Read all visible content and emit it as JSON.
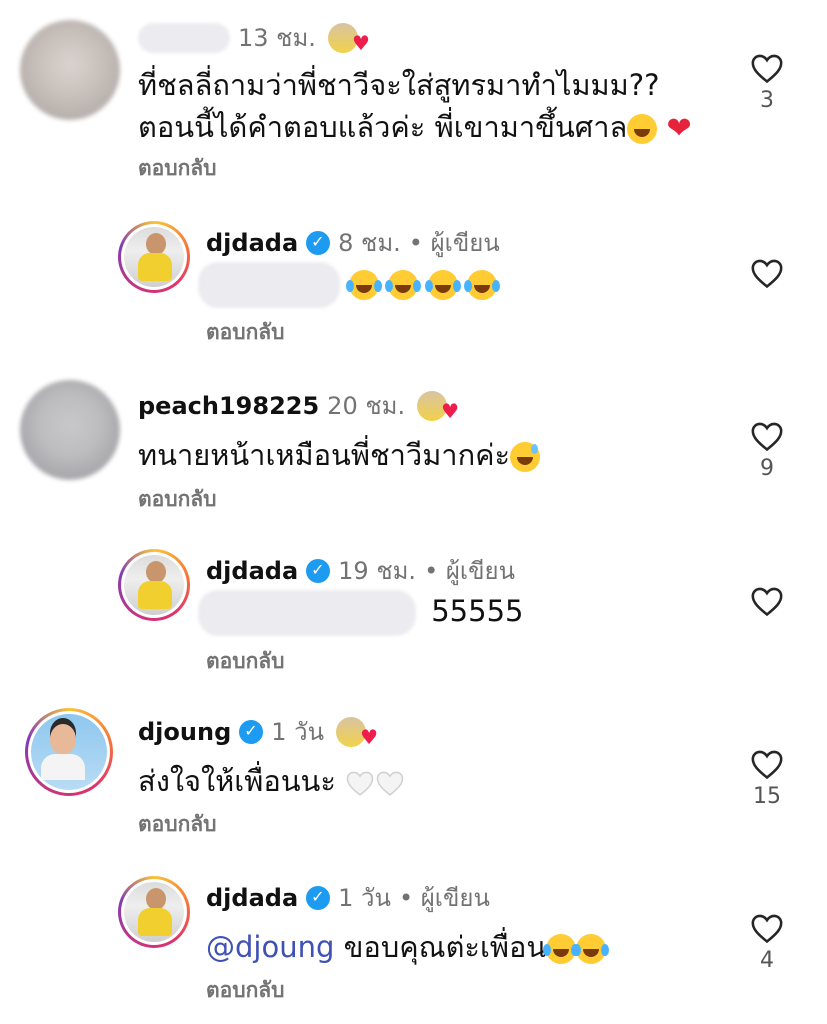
{
  "comments": [
    {
      "username": "",
      "time": "13 ชม.",
      "text_line1": "ที่ชลลี่ถามว่าพี่ชาวีจะใส่สูทรมาทำไมมม??",
      "text_line2": "ตอนนี้ได้คำตอบแล้วค่ะ พี่เขามาขึ้นศาล",
      "reply_label": "ตอบกลับ",
      "likes": "3"
    },
    {
      "username": "djdada",
      "time": "8 ชม.",
      "author_label": "• ผู้เขียน",
      "reply_label": "ตอบกลับ"
    },
    {
      "username": "peach198225",
      "time": "20 ชม.",
      "text": "ทนายหน้าเหมือนพี่ชาวีมากค่ะ",
      "reply_label": "ตอบกลับ",
      "likes": "9"
    },
    {
      "username": "djdada",
      "time": "19 ชม.",
      "author_label": "• ผู้เขียน",
      "text": "55555",
      "reply_label": "ตอบกลับ"
    },
    {
      "username": "djoung",
      "time": "1 วัน",
      "text": "ส่งใจให้เพื่อนนะ",
      "reply_label": "ตอบกลับ",
      "likes": "15"
    },
    {
      "username": "djdada",
      "time": "1 วัน",
      "author_label": "• ผู้เขียน",
      "mention": "@djoung",
      "text": "ขอบคุณต่ะเพื่อน",
      "reply_label": "ตอบกลับ",
      "likes": "4"
    }
  ],
  "icons": {
    "like": "heart-outline-icon",
    "verified": "verified-badge-icon",
    "author_liked": "author-liked-heart-icon"
  },
  "colors": {
    "secondary_text": "#737373",
    "verified_blue": "#1d9bf0",
    "mention": "#3f51b5",
    "heart_red": "#e6233b"
  }
}
